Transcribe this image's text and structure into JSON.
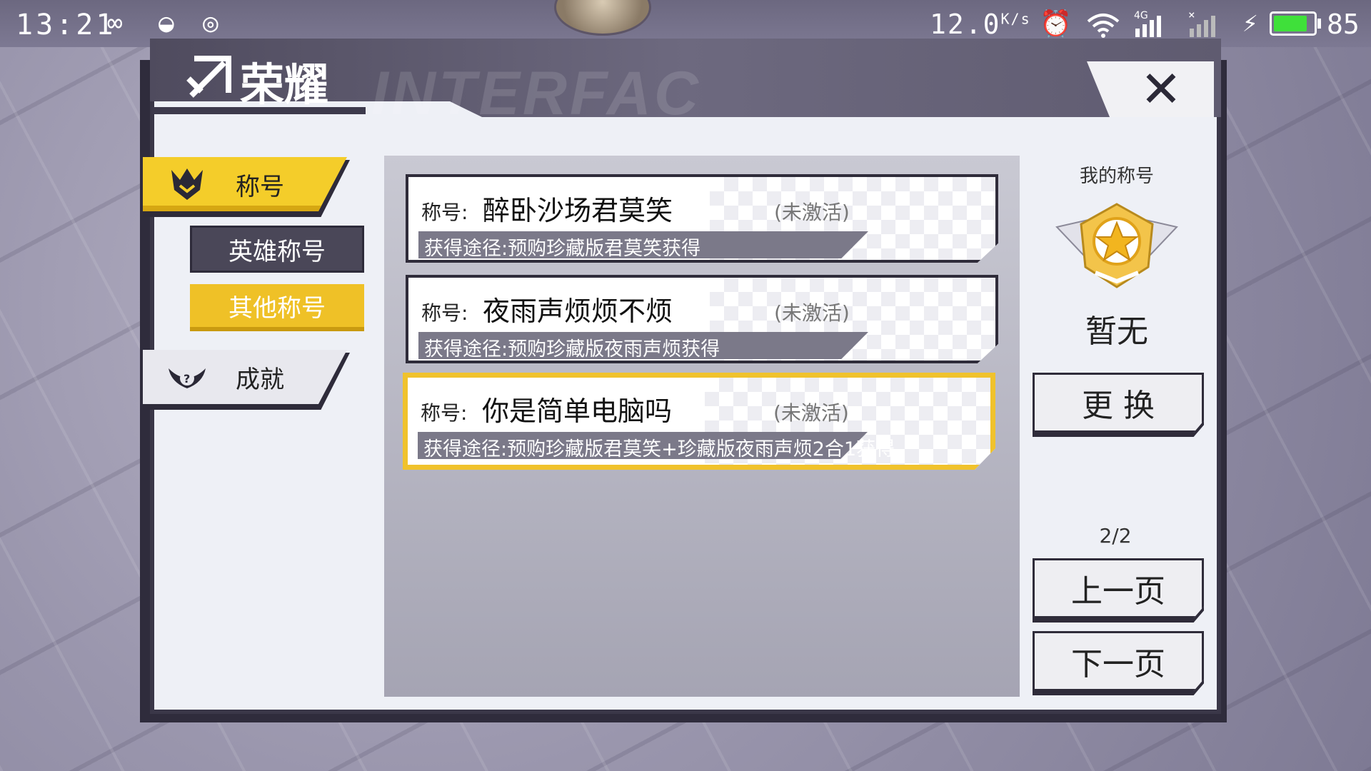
{
  "status_bar": {
    "time": "13:21",
    "net_speed": "12.0",
    "net_unit": "K/s",
    "net_badge": "4G",
    "battery": "85",
    "battery_fraction": 0.85
  },
  "header": {
    "title": "荣耀",
    "watermark": "INTERFAC"
  },
  "nav": {
    "titles_label": "称号",
    "hero_titles_label": "英雄称号",
    "other_titles_label": "其他称号",
    "achievements_label": "成就"
  },
  "list": {
    "prefix": "称号:",
    "items": [
      {
        "name": "醉卧沙场君莫笑",
        "status": "(未激活)",
        "source": "获得途径:预购珍藏版君莫笑获得"
      },
      {
        "name": "夜雨声烦烦不烦",
        "status": "(未激活)",
        "source": "获得途径:预购珍藏版夜雨声烦获得"
      },
      {
        "name": "你是简单电脑吗",
        "status": "(未激活)",
        "source": "获得途径:预购珍藏版君莫笑+珍藏版夜雨声烦2合1获得"
      }
    ]
  },
  "side": {
    "my_title_label": "我的称号",
    "current_title": "暂无",
    "change_button": "更 换",
    "page_indicator": "2/2",
    "prev_button": "上一页",
    "next_button": "下一页"
  },
  "colors": {
    "accent": "#f0c22c",
    "frame": "#2f2c3a"
  }
}
